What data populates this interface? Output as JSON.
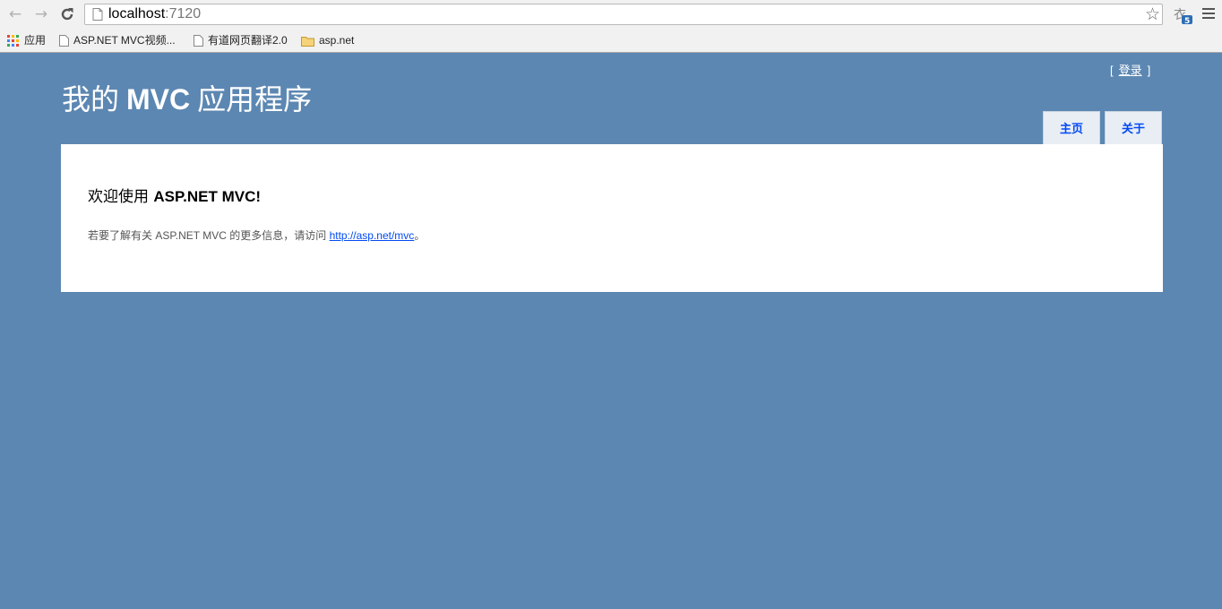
{
  "browser": {
    "url_host": "localhost",
    "url_port": ":7120",
    "bookmarks": [
      {
        "label": "应用",
        "icon": "apps-icon"
      },
      {
        "label": "ASP.NET MVC视频...",
        "icon": "page-icon"
      },
      {
        "label": "有道网页翻译2.0",
        "icon": "page-icon"
      },
      {
        "label": "asp.net",
        "icon": "folder-icon"
      }
    ]
  },
  "header": {
    "title_cn_1": "我的 ",
    "title_bold": "MVC",
    "title_cn_2": " 应用程序",
    "login_open": "[",
    "login_label": "登录",
    "login_close": "]"
  },
  "menu": {
    "home": "主页",
    "about": "关于"
  },
  "main": {
    "welcome_cn": "欢迎使用 ",
    "welcome_en": "ASP.NET MVC!",
    "info_prefix": "若要了解有关 ASP.NET MVC 的更多信息，请访问 ",
    "info_link": "http://asp.net/mvc",
    "info_suffix": "。"
  },
  "colors": {
    "page_background": "#5c87b2",
    "menu_tab_bg": "#e8eef4",
    "link": "#034af3"
  }
}
